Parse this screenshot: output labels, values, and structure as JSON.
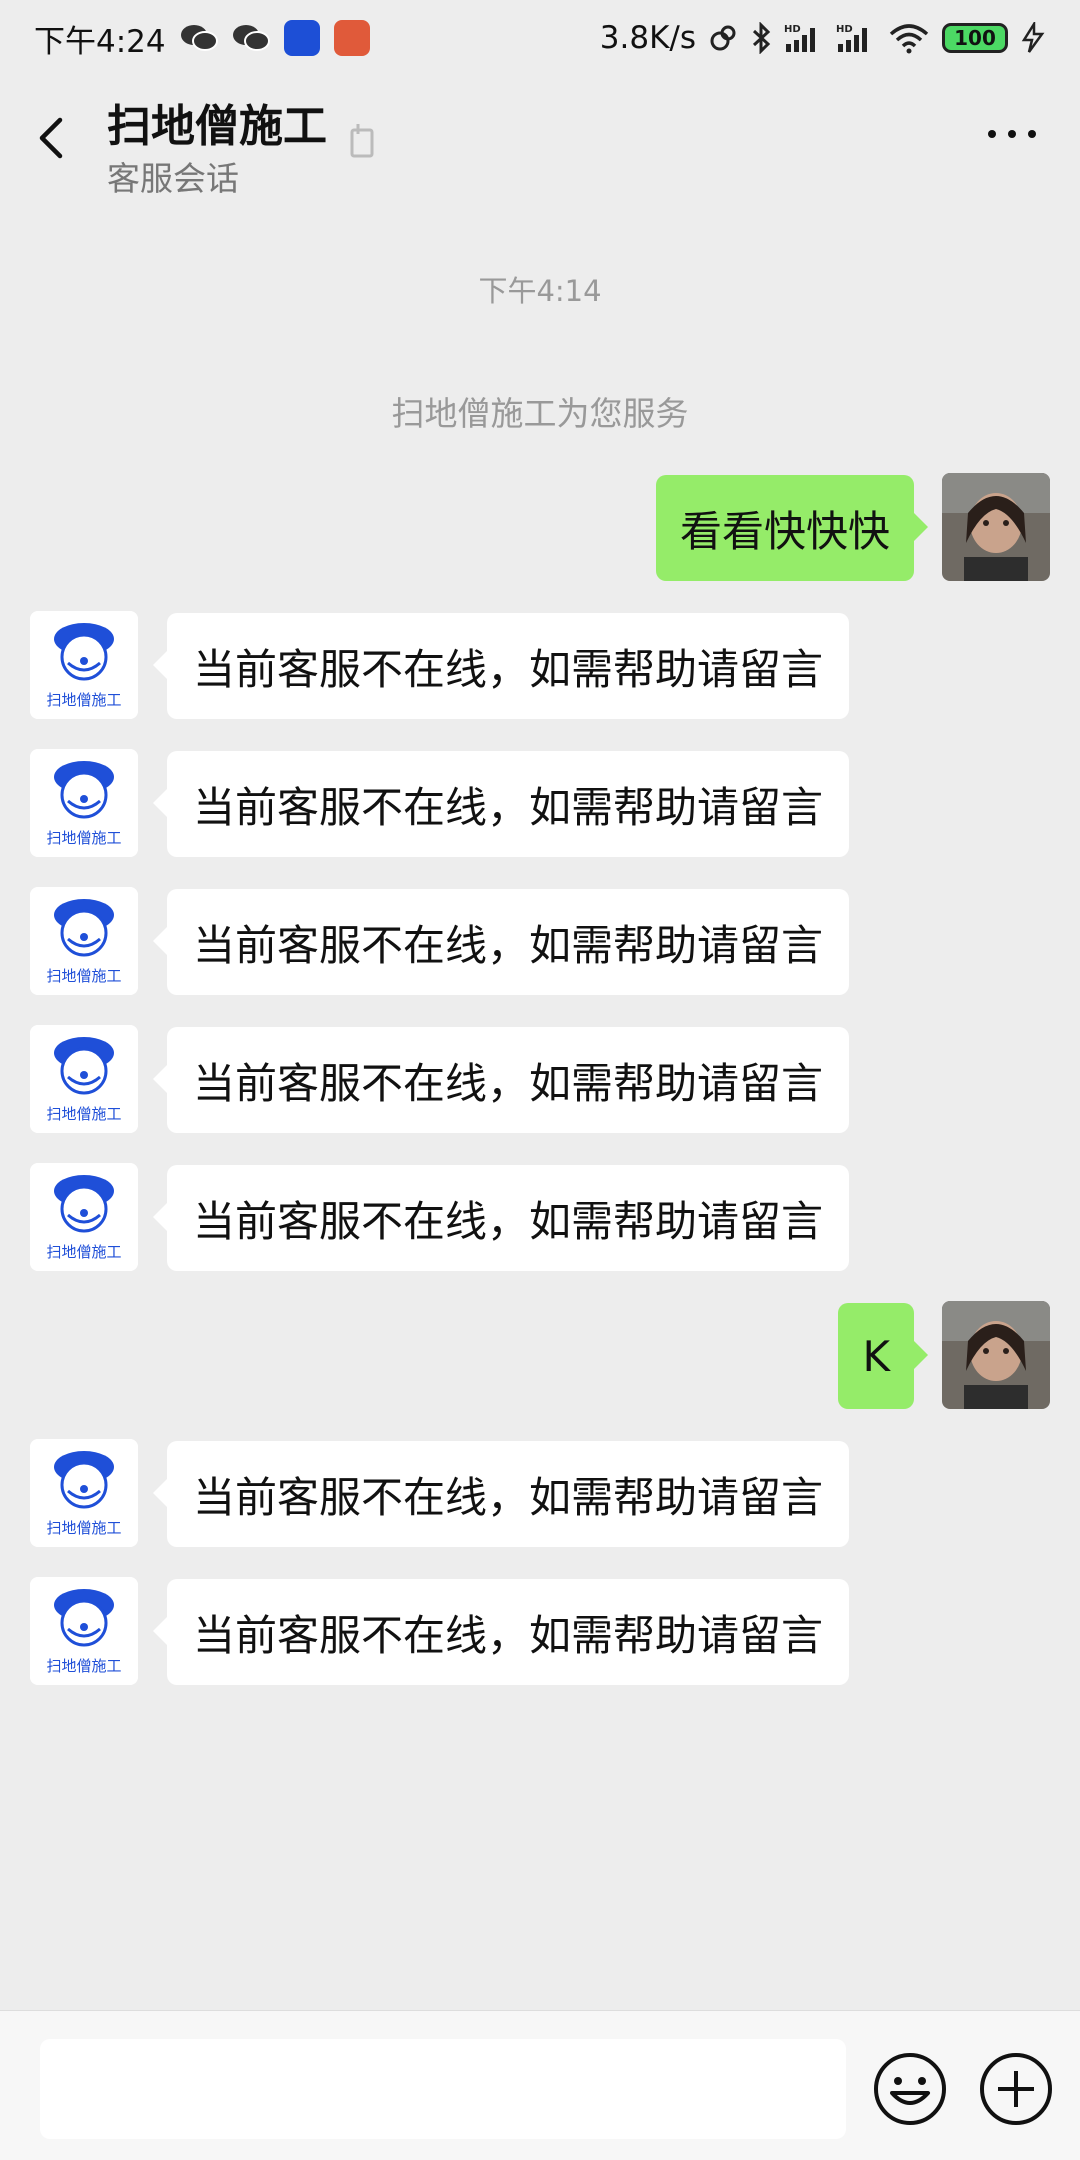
{
  "status_bar": {
    "time": "下午4:24",
    "speed": "3.8K/s",
    "battery": "100"
  },
  "header": {
    "title": "扫地僧施工",
    "subtitle": "客服会话"
  },
  "chat": {
    "timestamp": "下午4:14",
    "service_note": "扫地僧施工为您服务",
    "messages": [
      {
        "from": "user",
        "text": "看看快快快"
      },
      {
        "from": "bot",
        "text": "当前客服不在线，如需帮助请留言"
      },
      {
        "from": "bot",
        "text": "当前客服不在线，如需帮助请留言"
      },
      {
        "from": "bot",
        "text": "当前客服不在线，如需帮助请留言"
      },
      {
        "from": "bot",
        "text": "当前客服不在线，如需帮助请留言"
      },
      {
        "from": "bot",
        "text": "当前客服不在线，如需帮助请留言"
      },
      {
        "from": "user",
        "text": "K"
      },
      {
        "from": "bot",
        "text": "当前客服不在线，如需帮助请留言"
      },
      {
        "from": "bot",
        "text": "当前客服不在线，如需帮助请留言"
      }
    ],
    "bot_avatar_label": "扫地僧施工"
  },
  "input_bar": {
    "value": ""
  },
  "colors": {
    "background": "#ededed",
    "outgoing_bubble": "#95ec69",
    "incoming_bubble": "#ffffff",
    "logo_blue": "#1f4fd8"
  },
  "icons": {
    "back": "back-arrow-icon",
    "more": "more-dots-icon",
    "emoji": "emoji-icon",
    "plus": "plus-icon"
  }
}
